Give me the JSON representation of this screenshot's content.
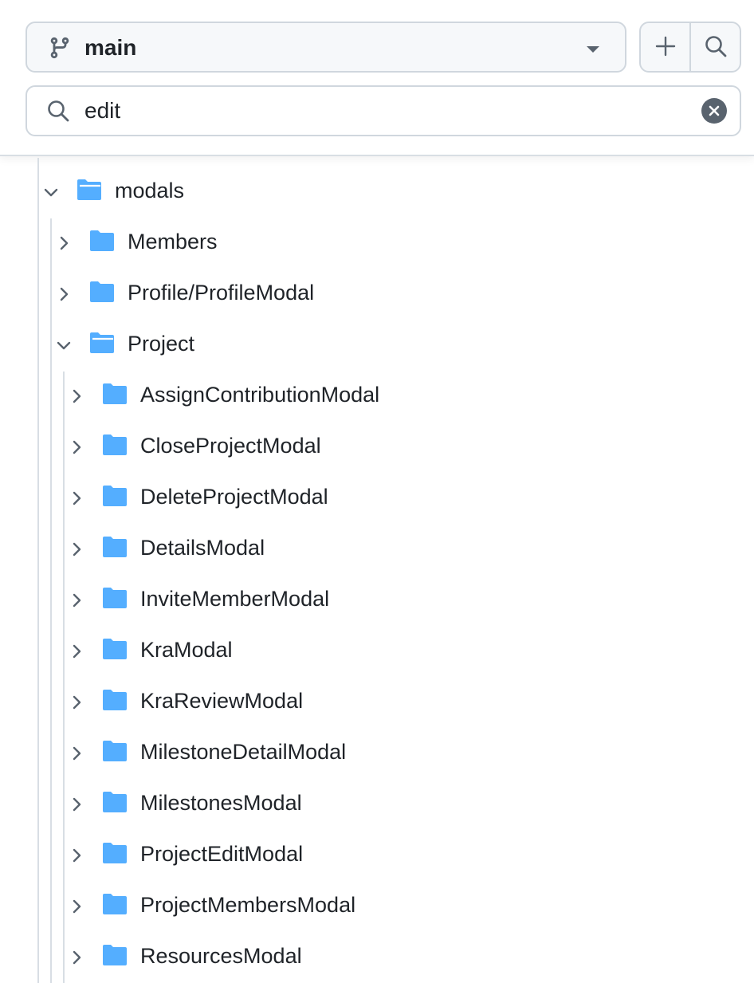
{
  "header": {
    "branch": {
      "name": "main",
      "icon": "git-branch-icon"
    },
    "add_button_icon": "plus-icon",
    "search_button_icon": "search-icon",
    "filter": {
      "value": "edit",
      "icon": "search-icon",
      "clear_icon": "x-circle-icon"
    }
  },
  "tree": {
    "root": {
      "label": "modals",
      "expanded": true,
      "icon": "folder-open-icon"
    },
    "level1": [
      {
        "label": "Members",
        "expanded": false
      },
      {
        "label": "Profile/ProfileModal",
        "expanded": false
      },
      {
        "label": "Project",
        "expanded": true
      }
    ],
    "project_children": [
      {
        "label": "AssignContributionModal"
      },
      {
        "label": "CloseProjectModal"
      },
      {
        "label": "DeleteProjectModal"
      },
      {
        "label": "DetailsModal"
      },
      {
        "label": "InviteMemberModal"
      },
      {
        "label": "KraModal"
      },
      {
        "label": "KraReviewModal"
      },
      {
        "label": "MilestoneDetailModal"
      },
      {
        "label": "MilestonesModal"
      },
      {
        "label": "ProjectEditModal"
      },
      {
        "label": "ProjectMembersModal"
      },
      {
        "label": "ResourcesModal"
      }
    ]
  },
  "colors": {
    "folder": "#54aeff",
    "text": "#1f2328",
    "muted_icon": "#59636e",
    "border": "#d0d7de",
    "button_bg": "#f6f8fa"
  }
}
